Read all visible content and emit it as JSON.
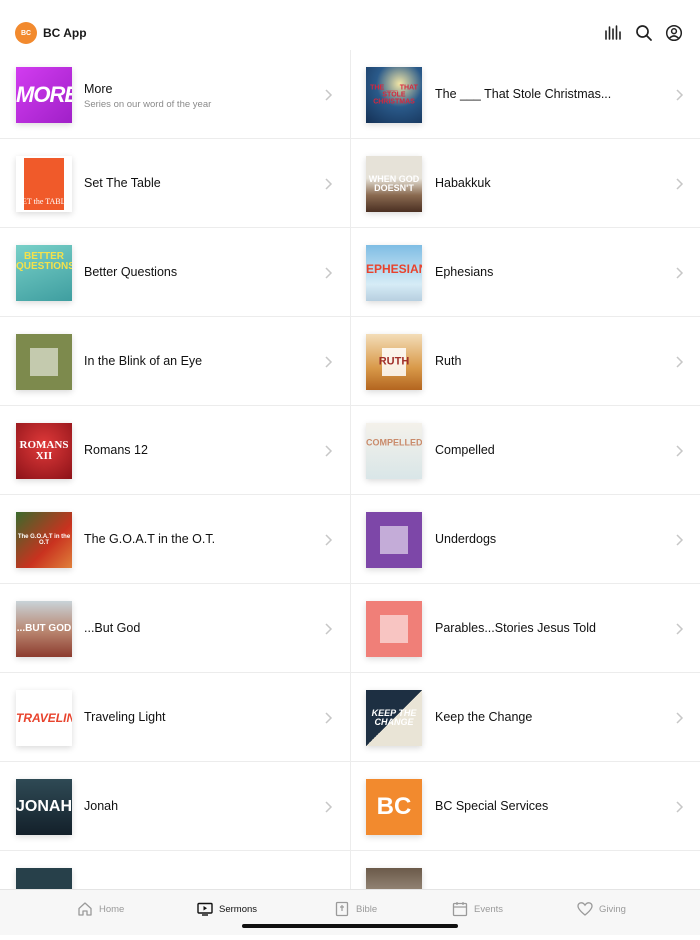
{
  "app": {
    "logo_text": "BC",
    "title": "BC App"
  },
  "header_icons": [
    "audio-bars-icon",
    "search-icon",
    "account-icon"
  ],
  "left_items": [
    {
      "title": "More",
      "subtitle": "Series on our word of the year",
      "thumb": "MORE",
      "bg": "#c633e6"
    },
    {
      "title": "Set The Table",
      "subtitle": "",
      "thumb": "SET the TABLE",
      "bg": "#f05a2a"
    },
    {
      "title": "Better Questions",
      "subtitle": "",
      "thumb": "BETTER QUESTIONS",
      "bg": "#5bb8b4"
    },
    {
      "title": "In the Blink of an Eye",
      "subtitle": "",
      "thumb": "",
      "bg": "#7d8a4d"
    },
    {
      "title": "Romans 12",
      "subtitle": "",
      "thumb": "ROMANS XII",
      "bg": "#b81d24"
    },
    {
      "title": "The G.O.A.T in the O.T.",
      "subtitle": "",
      "thumb": "The G.O.A.T in the O.T",
      "bg": "#c9321f"
    },
    {
      "title": "...But God",
      "subtitle": "",
      "thumb": "...BUT GOD",
      "bg": "#a55040"
    },
    {
      "title": "Traveling Light",
      "subtitle": "",
      "thumb": "TRAVELING",
      "bg": "#ffffff"
    },
    {
      "title": "Jonah",
      "subtitle": "",
      "thumb": "JONAH",
      "bg": "#1f2d33"
    }
  ],
  "right_items": [
    {
      "title": "The ___ That Stole Christmas...",
      "thumb": "THE ___ THAT STOLE CHRISTMAS",
      "bg": "#1e3f6e"
    },
    {
      "title": "Habakkuk",
      "thumb": "WHEN GOD DOESN'T",
      "bg": "#5a3b2c"
    },
    {
      "title": "Ephesians",
      "thumb": "EPHESIANS",
      "bg": "#8fc7e8"
    },
    {
      "title": "Ruth",
      "thumb": "RUTH",
      "bg": "#d9a75a"
    },
    {
      "title": "Compelled",
      "thumb": "COMPELLED",
      "bg": "#e6e3dc"
    },
    {
      "title": "Underdogs",
      "thumb": "",
      "bg": "#7d47a8"
    },
    {
      "title": "Parables...Stories Jesus Told",
      "thumb": "",
      "bg": "#f07f78"
    },
    {
      "title": "Keep the Change",
      "thumb": "KEEP THE CHANGE",
      "bg": "#223447"
    },
    {
      "title": "BC Special Services",
      "thumb": "BC",
      "bg": "#f28a2e"
    }
  ],
  "tabs": [
    {
      "label": "Home",
      "icon": "home-icon",
      "active": false
    },
    {
      "label": "Sermons",
      "icon": "tv-icon",
      "active": true
    },
    {
      "label": "Bible",
      "icon": "bible-icon",
      "active": false
    },
    {
      "label": "Events",
      "icon": "calendar-icon",
      "active": false
    },
    {
      "label": "Giving",
      "icon": "heart-icon",
      "active": false
    }
  ]
}
